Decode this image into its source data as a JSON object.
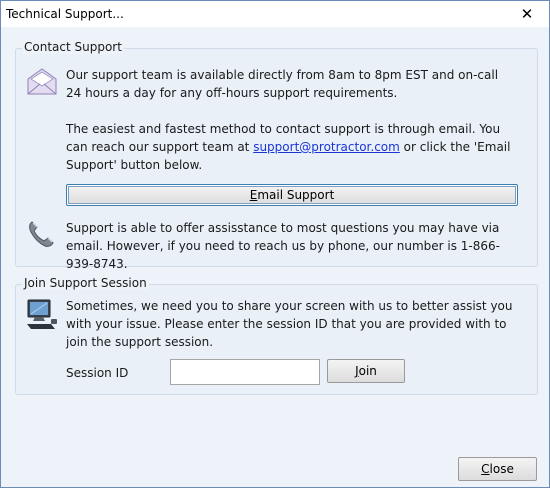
{
  "window": {
    "title": "Technical Support...",
    "close_glyph": "✕"
  },
  "contact": {
    "legend": "Contact Support",
    "intro": "Our support team is available directly from 8am to 8pm EST and on-call 24 hours a day for any off-hours support requirements.",
    "email_text_before": "The easiest and fastest method to contact support is through email. You can reach our support team at ",
    "email_link": "support@protractor.com",
    "email_text_after": " or click the 'Email Support' button below.",
    "email_button_first": "E",
    "email_button_rest": "mail Support",
    "phone_text": "Support is able to offer assisstance to most questions you may have via email. However, if you need to reach us by phone, our number is 1-866-939-8743."
  },
  "session": {
    "legend": "Join Support Session",
    "text": "Sometimes, we need you to share your screen with us to better assist you with your issue. Please enter the session ID that you are provided with to join the support session.",
    "label": "Session ID",
    "input_value": "",
    "join_first": "J",
    "join_rest": "oin"
  },
  "footer": {
    "close_first": "C",
    "close_rest": "lose"
  },
  "icons": {
    "envelope": "envelope-icon",
    "phone": "telephone-icon",
    "computer": "computer-icon"
  }
}
